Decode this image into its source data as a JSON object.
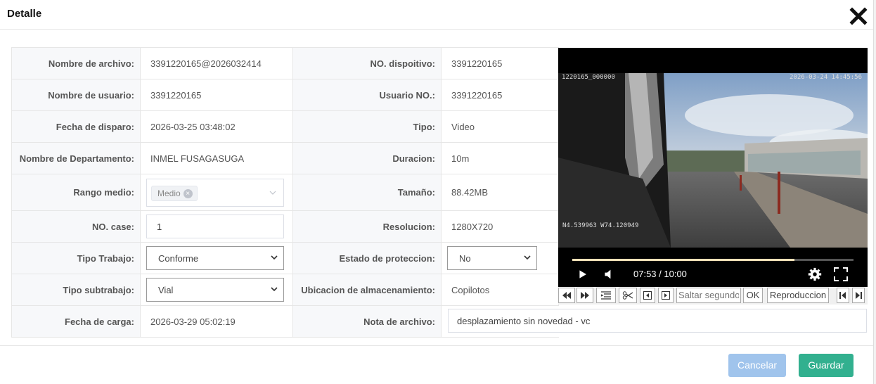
{
  "dialog": {
    "title": "Detalle"
  },
  "form": {
    "rows": [
      {
        "l1": "Nombre de archivo:",
        "v1": "3391220165@2026032414",
        "l2": "NO. dispoitivo:",
        "v2": "3391220165"
      },
      {
        "l1": "Nombre de usuario:",
        "v1": "3391220165",
        "l2": "Usuario NO.:",
        "v2": "3391220165"
      },
      {
        "l1": "Fecha de disparo:",
        "v1": "2026-03-25 03:48:02",
        "l2": "Tipo:",
        "v2": "Video"
      },
      {
        "l1": "Nombre de Departamento:",
        "v1": "INMEL FUSAGASUGA",
        "l2": "Duracion:",
        "v2": "10m"
      },
      {
        "l1": "Rango medio:",
        "v1": "",
        "l2": "Tamaño:",
        "v2": "88.42MB"
      },
      {
        "l1": "NO. case:",
        "v1": "",
        "l2": "Resolucion:",
        "v2": "1280X720"
      },
      {
        "l1": "Tipo Trabajo:",
        "v1": "",
        "l2": "Estado de proteccion:",
        "v2": ""
      },
      {
        "l1": "Tipo subtrabajo:",
        "v1": "",
        "l2": "Ubicacion de almacenamiento:",
        "v2": "Copilotos"
      },
      {
        "l1": "Fecha de carga:",
        "v1": "2026-03-29 05:02:19",
        "l2": "Nota de archivo:",
        "v2": ""
      }
    ],
    "rango_tag": "Medio",
    "case_value": "1",
    "tipo_trabajo": "Conforme",
    "tipo_subtrabajo": "Vial",
    "estado_proteccion": "No",
    "nota_archivo": "desplazamiento sin novedad - vc"
  },
  "video": {
    "osd_top_left": "1220165_000000",
    "osd_top_right": "2026-03-24 14:45:56",
    "osd_coords": "N4.539963  W74.120949",
    "time": "07:53 / 10:00",
    "progress": 0.79
  },
  "toolbar": {
    "seek_placeholder": "Saltar segundos",
    "ok_label": "OK",
    "play_label": "Reproduccion"
  },
  "footer": {
    "cancel_label": "Cancelar",
    "save_label": "Guardar",
    "cancel_color": "#a0c4ec",
    "save_color": "#32b08f"
  }
}
